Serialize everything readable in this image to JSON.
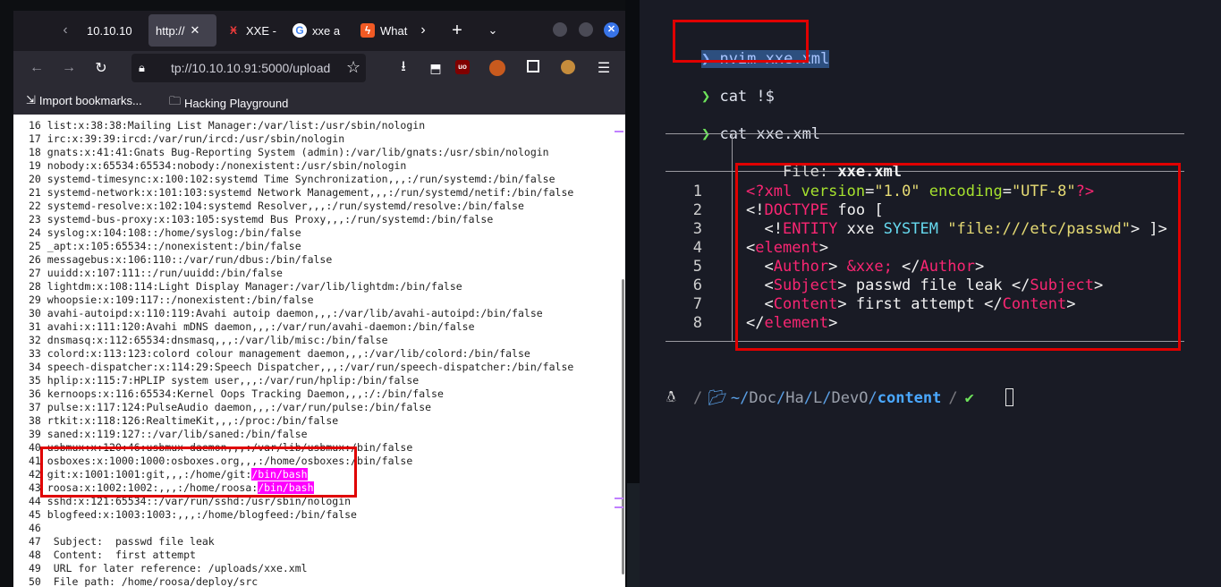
{
  "browser": {
    "tabs": [
      {
        "label": "10.10.10",
        "icon": "generic",
        "active": false
      },
      {
        "label": "http://",
        "icon": "none",
        "active": true
      },
      {
        "label": "XXE -",
        "icon": "hackthebox-icon",
        "active": false
      },
      {
        "label": "xxe a",
        "icon": "google-icon",
        "active": false
      },
      {
        "label": "What",
        "icon": "bolt-icon",
        "active": false
      }
    ],
    "url": "tp://10.10.10.91:5000/upload",
    "bookmarks": {
      "import": "Import bookmarks...",
      "folder": "Hacking Playground"
    }
  },
  "passwd_lines": [
    {
      "n": "16",
      "text": "list:x:38:38:Mailing List Manager:/var/list:/usr/sbin/nologin"
    },
    {
      "n": "17",
      "text": "irc:x:39:39:ircd:/var/run/ircd:/usr/sbin/nologin"
    },
    {
      "n": "18",
      "text": "gnats:x:41:41:Gnats Bug-Reporting System (admin):/var/lib/gnats:/usr/sbin/nologin"
    },
    {
      "n": "19",
      "text": "nobody:x:65534:65534:nobody:/nonexistent:/usr/sbin/nologin"
    },
    {
      "n": "20",
      "text": "systemd-timesync:x:100:102:systemd Time Synchronization,,,:/run/systemd:/bin/false"
    },
    {
      "n": "21",
      "text": "systemd-network:x:101:103:systemd Network Management,,,:/run/systemd/netif:/bin/false"
    },
    {
      "n": "22",
      "text": "systemd-resolve:x:102:104:systemd Resolver,,,:/run/systemd/resolve:/bin/false"
    },
    {
      "n": "23",
      "text": "systemd-bus-proxy:x:103:105:systemd Bus Proxy,,,:/run/systemd:/bin/false"
    },
    {
      "n": "24",
      "text": "syslog:x:104:108::/home/syslog:/bin/false"
    },
    {
      "n": "25",
      "text": "_apt:x:105:65534::/nonexistent:/bin/false"
    },
    {
      "n": "26",
      "text": "messagebus:x:106:110::/var/run/dbus:/bin/false"
    },
    {
      "n": "27",
      "text": "uuidd:x:107:111::/run/uuidd:/bin/false"
    },
    {
      "n": "28",
      "text": "lightdm:x:108:114:Light Display Manager:/var/lib/lightdm:/bin/false"
    },
    {
      "n": "29",
      "text": "whoopsie:x:109:117::/nonexistent:/bin/false"
    },
    {
      "n": "30",
      "text": "avahi-autoipd:x:110:119:Avahi autoip daemon,,,:/var/lib/avahi-autoipd:/bin/false"
    },
    {
      "n": "31",
      "text": "avahi:x:111:120:Avahi mDNS daemon,,,:/var/run/avahi-daemon:/bin/false"
    },
    {
      "n": "32",
      "text": "dnsmasq:x:112:65534:dnsmasq,,,:/var/lib/misc:/bin/false"
    },
    {
      "n": "33",
      "text": "colord:x:113:123:colord colour management daemon,,,:/var/lib/colord:/bin/false"
    },
    {
      "n": "34",
      "text": "speech-dispatcher:x:114:29:Speech Dispatcher,,,:/var/run/speech-dispatcher:/bin/false"
    },
    {
      "n": "35",
      "text": "hplip:x:115:7:HPLIP system user,,,:/var/run/hplip:/bin/false"
    },
    {
      "n": "36",
      "text": "kernoops:x:116:65534:Kernel Oops Tracking Daemon,,,:/:/bin/false"
    },
    {
      "n": "37",
      "text": "pulse:x:117:124:PulseAudio daemon,,,:/var/run/pulse:/bin/false"
    },
    {
      "n": "38",
      "text": "rtkit:x:118:126:RealtimeKit,,,:/proc:/bin/false"
    },
    {
      "n": "39",
      "text": "saned:x:119:127::/var/lib/saned:/bin/false"
    },
    {
      "n": "40",
      "text": "usbmux:x:120:46:usbmux daemon,,,:/var/lib/usbmux:/bin/false"
    },
    {
      "n": "41",
      "text": "osboxes:x:1000:1000:osboxes.org,,,:/home/osboxes:/bin/false"
    },
    {
      "n": "42",
      "text": "git:x:1001:1001:git,,,:/home/git:",
      "hl": "/bin/bash"
    },
    {
      "n": "43",
      "text": "roosa:x:1002:1002:,,,:/home/roosa:",
      "hl": "/bin/bash"
    },
    {
      "n": "44",
      "text": "sshd:x:121:65534::/var/run/sshd:/usr/sbin/nologin"
    },
    {
      "n": "45",
      "text": "blogfeed:x:1003:1003:,,,:/home/blogfeed:/bin/false"
    },
    {
      "n": "46",
      "text": ""
    },
    {
      "n": "47",
      "text": " Subject:  passwd file leak"
    },
    {
      "n": "48",
      "text": " Content:  first attempt"
    },
    {
      "n": "49",
      "text": " URL for later reference: /uploads/xxe.xml"
    },
    {
      "n": "50",
      "text": " File path: /home/roosa/deploy/src"
    }
  ],
  "terminal": {
    "prompt_symbol": "❯",
    "commands": [
      "nvim xxe.xml",
      "cat !$",
      "cat xxe.xml"
    ],
    "file_label": "File: ",
    "file_name": "xxe.xml",
    "code_line_numbers": [
      "1",
      "2",
      "3",
      "4",
      "5",
      "6",
      "7",
      "8"
    ],
    "statusline": {
      "os_icon": "linux-icon",
      "path_prefix": "~/",
      "path_parts": [
        "Doc",
        "Ha",
        "L",
        "DevO"
      ],
      "path_current": "content",
      "check": "✔"
    }
  },
  "colors": {
    "highlight": "#ff00ff",
    "annotation_box": "#e00000",
    "prompt_green": "#6ee35b"
  }
}
